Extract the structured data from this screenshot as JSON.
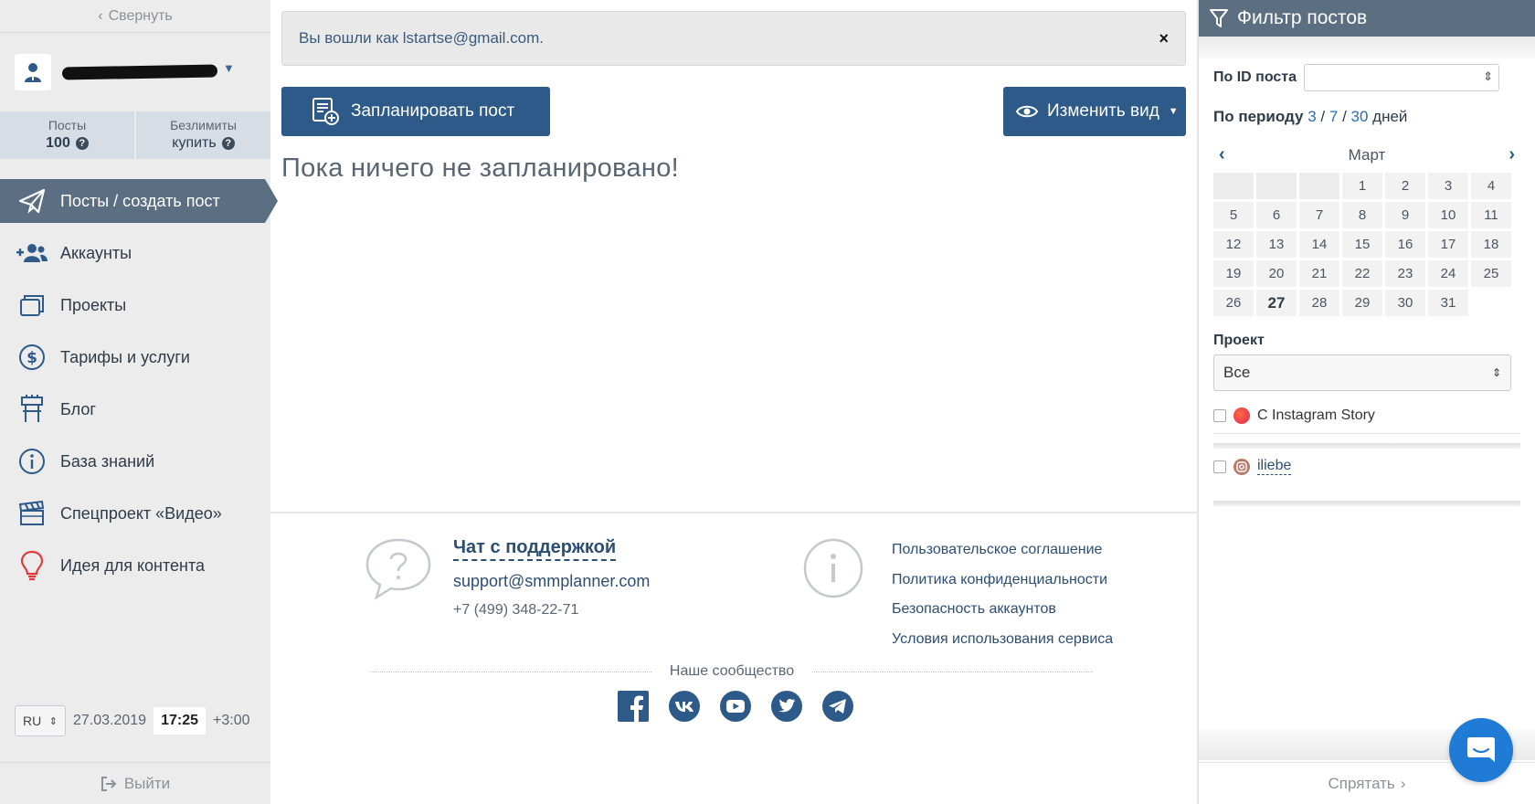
{
  "sidebar": {
    "collapse_label": "Свернуть",
    "stats": [
      {
        "label": "Посты",
        "value": "100"
      },
      {
        "label": "Безлимиты",
        "value": "купить"
      }
    ],
    "nav": [
      {
        "label": "Посты / создать пост",
        "icon": "paper-plane-icon",
        "active": true
      },
      {
        "label": "Аккаунты",
        "icon": "users-icon"
      },
      {
        "label": "Проекты",
        "icon": "projects-icon"
      },
      {
        "label": "Тарифы и услуги",
        "icon": "dollar-icon"
      },
      {
        "label": "Блог",
        "icon": "blog-icon"
      },
      {
        "label": "База знаний",
        "icon": "info-icon"
      },
      {
        "label": "Спецпроект «Видео»",
        "icon": "clapperboard-icon"
      },
      {
        "label": "Идея для контента",
        "icon": "lightbulb-icon"
      }
    ],
    "lang": "RU",
    "date": "27.03.2019",
    "time": "17:25",
    "timezone": "+3:00",
    "logout_label": "Выйти"
  },
  "main": {
    "alert_text": "Вы вошли как lstartse@gmail.com.",
    "alert_close": "×",
    "schedule_button": "Запланировать пост",
    "view_button": "Изменить вид",
    "empty_title": "Пока ничего не запланировано!"
  },
  "footer": {
    "chat_title": "Чат с поддержкой",
    "email": "support@smmplanner.com",
    "phone": "+7 (499) 348-22-71",
    "links": [
      "Пользовательское соглашение",
      "Политика конфиденциальности",
      "Безопасность аккаунтов",
      "Условия использования сервиса"
    ],
    "community_label": "Наше сообщество",
    "socials": [
      "facebook-icon",
      "vk-icon",
      "youtube-icon",
      "twitter-icon",
      "telegram-icon"
    ]
  },
  "filter": {
    "title": "Фильтр постов",
    "by_id_label": "По ID поста",
    "period_label": "По периоду",
    "period_options": [
      "3",
      "7",
      "30"
    ],
    "period_unit": "дней",
    "month": "Март",
    "calendar_days": [
      "",
      "",
      "",
      "1",
      "2",
      "3",
      "4",
      "5",
      "6",
      "7",
      "8",
      "9",
      "10",
      "11",
      "12",
      "13",
      "14",
      "15",
      "16",
      "17",
      "18",
      "19",
      "20",
      "21",
      "22",
      "23",
      "24",
      "25",
      "26",
      "27",
      "28",
      "29",
      "30",
      "31"
    ],
    "today": "27",
    "project_label": "Проект",
    "project_value": "Все",
    "story_option": "С Instagram Story",
    "account_name": "iliebe",
    "hide_label": "Спрятать"
  },
  "colors": {
    "accent": "#2d5a88",
    "sidebar_active": "#5b6e82",
    "link": "#2c4e73",
    "chat_fab": "#1f7bd6"
  }
}
